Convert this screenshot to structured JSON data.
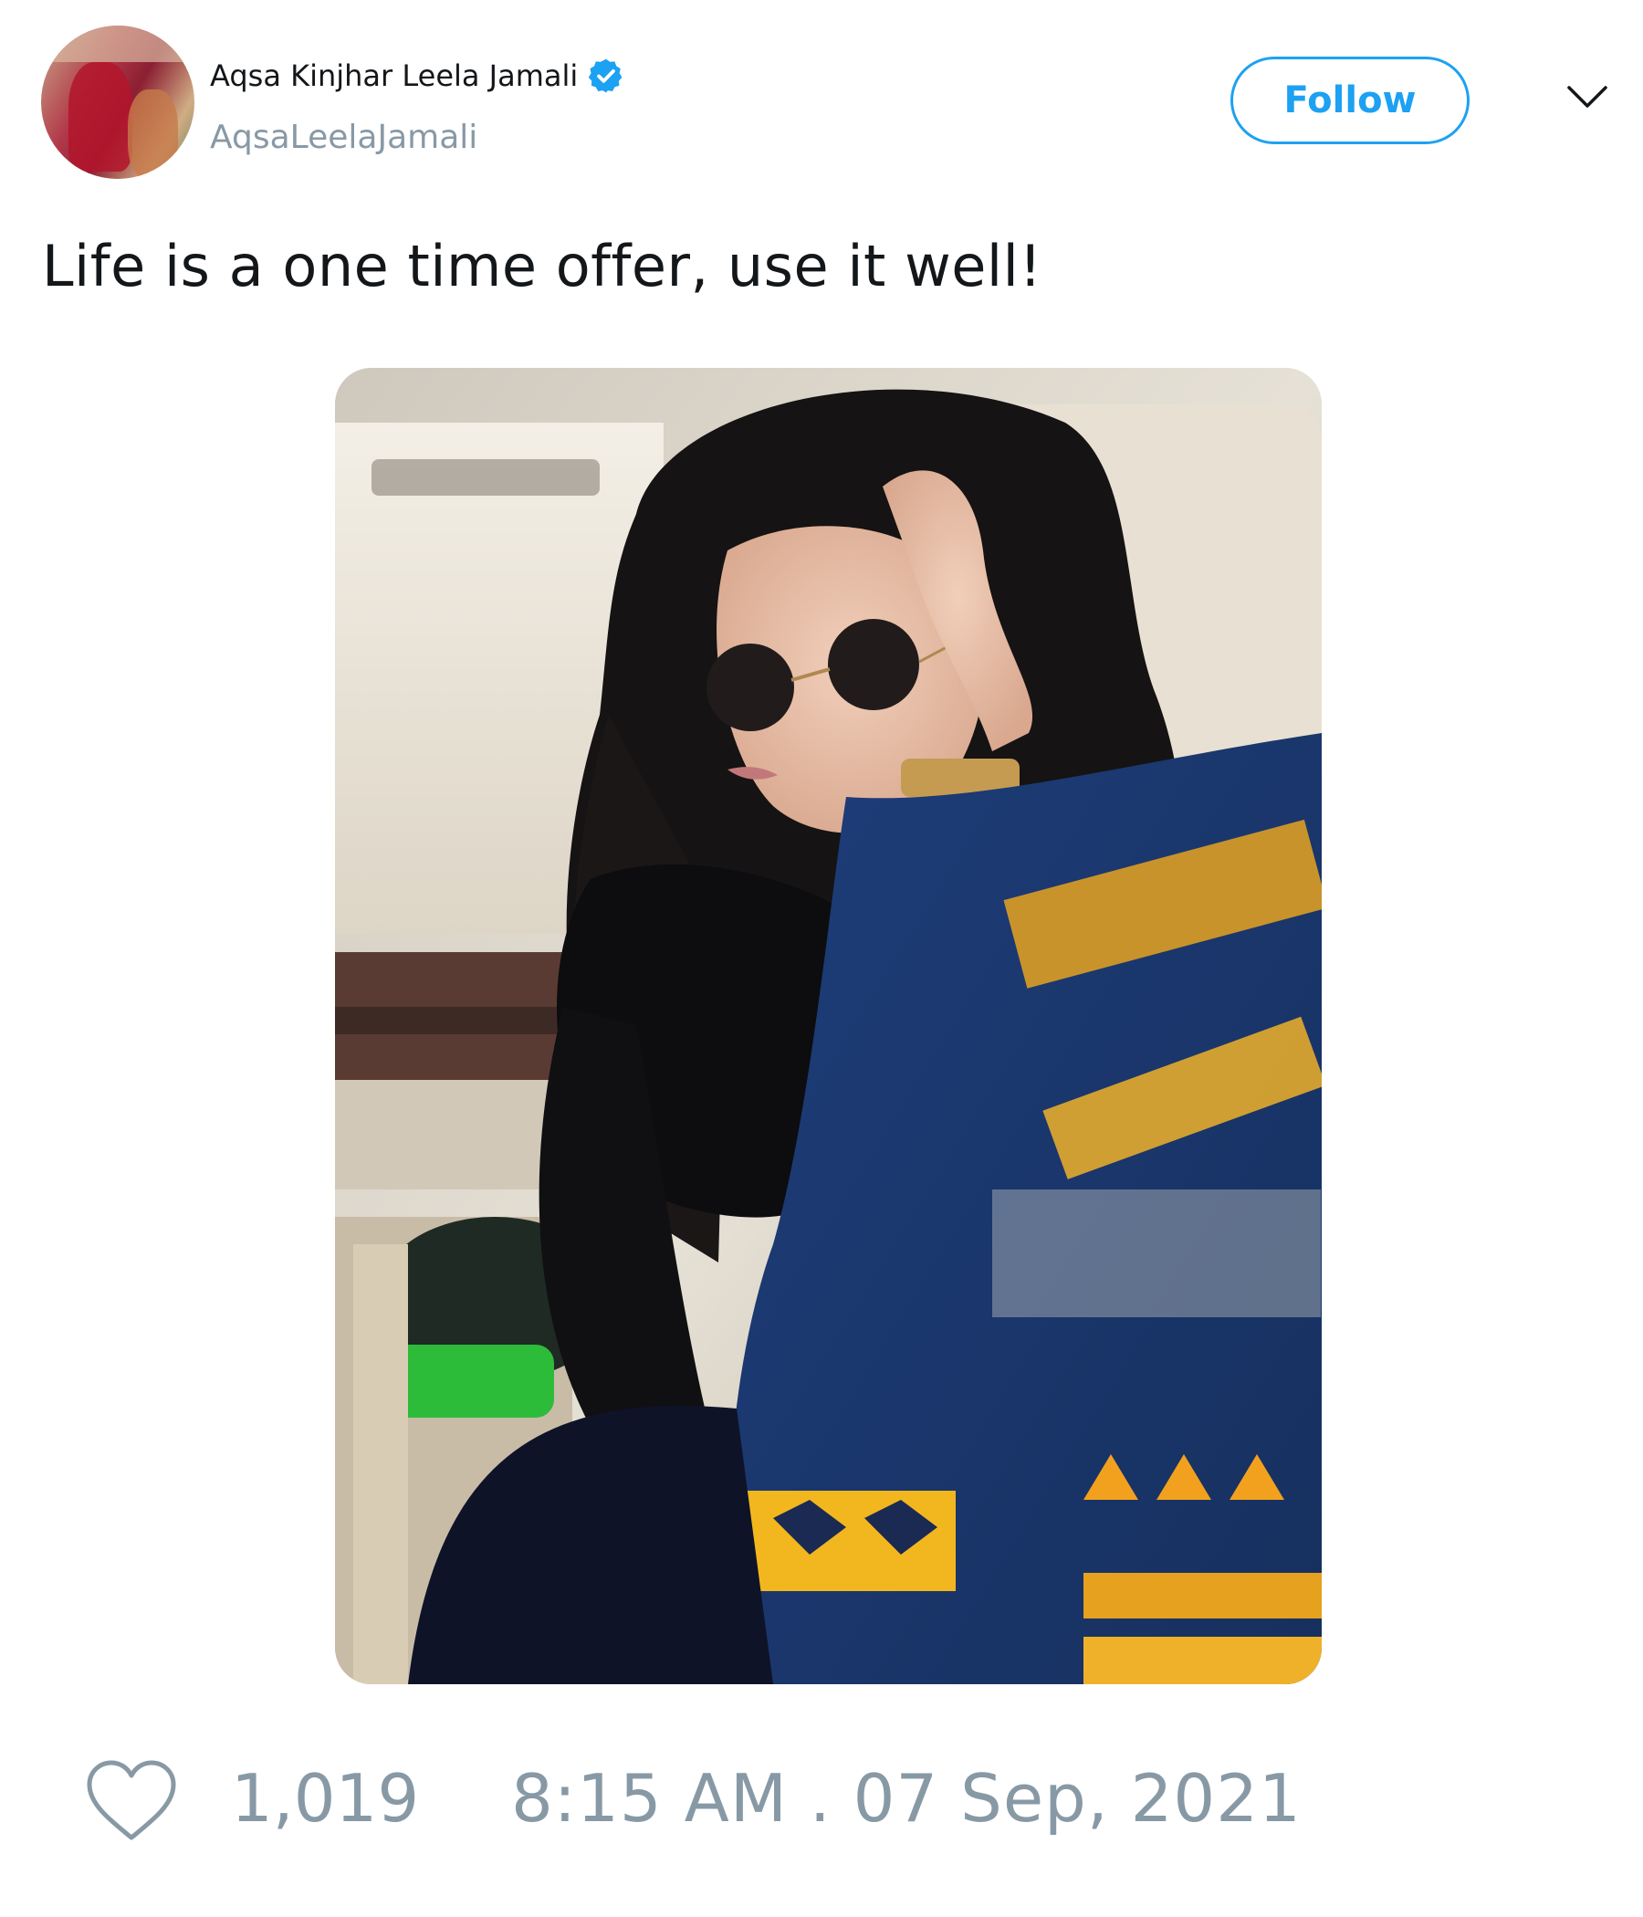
{
  "user": {
    "display_name": "Aqsa Kinjhar Leela Jamali",
    "handle": "AqsaLeelaJamali",
    "verified": true
  },
  "actions": {
    "follow_label": "Follow",
    "menu_icon": "chevron-down-icon"
  },
  "tweet": {
    "text": "Life is a one time offer, use it well!",
    "media_type": "photo"
  },
  "footer": {
    "like_icon": "heart-icon",
    "like_count": "1,019",
    "timestamp": "8:15 AM . 07 Sep, 2021"
  },
  "colors": {
    "accent": "#1da1f2",
    "muted": "#8899a6",
    "text": "#14171a"
  }
}
